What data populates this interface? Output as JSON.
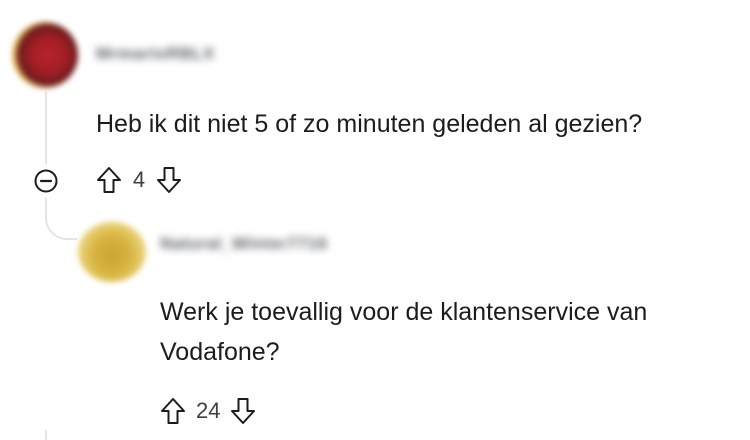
{
  "thread": {
    "collapse_icon": "minus-circle-icon",
    "comments": [
      {
        "username": "MrmarioRBLX",
        "avatar_colors": [
          "#a31e26",
          "#e7c15a"
        ],
        "body": "Heb ik dit niet 5 of zo minuten geleden al gezien?",
        "votes": "4"
      },
      {
        "username": "Natural_Winter7716",
        "avatar_colors": [
          "#d7b443",
          "#f4e6b3"
        ],
        "body_lines": [
          "Werk je toevallig voor de klantenservice van",
          "Vodafone?"
        ],
        "votes": "24"
      }
    ]
  },
  "icons": {
    "upvote": "arrow-up-outline-icon",
    "downvote": "arrow-down-outline-icon"
  },
  "colors": {
    "text": "#1c1c1c",
    "thread_line": "#e4e4e4",
    "icon": "#1c1c1c"
  }
}
